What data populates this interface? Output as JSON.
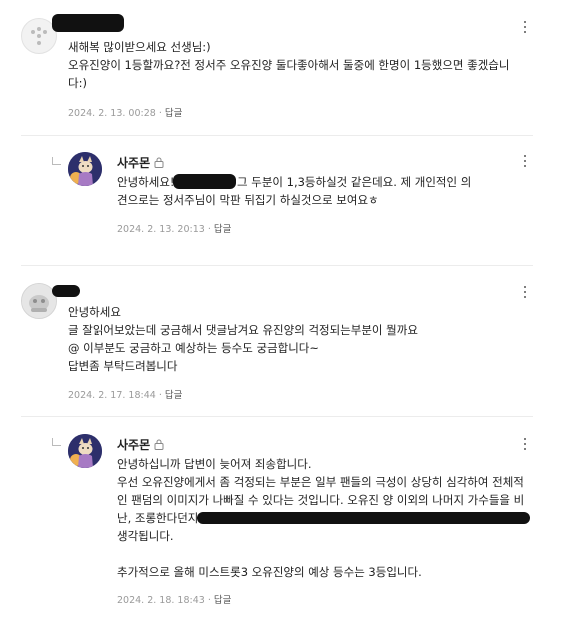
{
  "comments": [
    {
      "author": "",
      "lines": [
        "새해복 많이받으세요 선생님:)",
        "오유진양이 1등할까요?전 정서주 오유진양 둘다좋아해서 둘중에 한명이 1등했으면 좋겠습니",
        "다:)"
      ],
      "date": "2024. 2. 13. 00:28",
      "reply_label": "답글"
    },
    {
      "author": "사주몬",
      "lines": [
        "안녕하세요!                    !! ㅎㅎ저도 그 두분이 1,3등하실것 같은데요. 제 개인적인 의",
        "견으로는 정서주님이 막판 뒤집기 하실것으로 보여요ㅎ"
      ],
      "date": "2024. 2. 13. 20:13",
      "reply_label": "답글"
    },
    {
      "author": "",
      "lines": [
        "안녕하세요",
        "글 잘읽어보았는데 궁금해서 댓글남겨요 유진양의 걱정되는부분이 뭘까요",
        "@ 이부분도 궁금하고 예상하는 등수도 궁금합니다~",
        "답변좀 부탁드려봅니다"
      ],
      "date": "2024. 2. 17. 18:44",
      "reply_label": "답글"
    },
    {
      "author": "사주몬",
      "lines": [
        "안녕하십니까 답변이 늦어져 죄송합니다.",
        "우선 오유진양에게서 좀 걱정되는 부분은 일부 팬들의 극성이 상당히 심각하여 전체적",
        "인 팬덤의 이미지가 나빠질 수 있다는 것입니다. 오유진 양 이외의 나머지 가수들을 비",
        "난, 조롱한다던지 혹시 다른 가수 팬분들을 모욕하는 등의 행동은 자제해야 한다고",
        "생각됩니다.",
        "",
        "추가적으로 올해 미스트롯3 오유진양의 예상 등수는 3등입니다."
      ],
      "date": "2024. 2. 18. 18:43",
      "reply_label": "답글"
    }
  ],
  "colors": {
    "text": "#222222",
    "meta": "#9a9a9a",
    "divider": "#ececec"
  },
  "icons": {
    "more": "more-vertical-icon",
    "lock": "lock-icon",
    "reply_elbow": "reply-arrow-icon"
  }
}
